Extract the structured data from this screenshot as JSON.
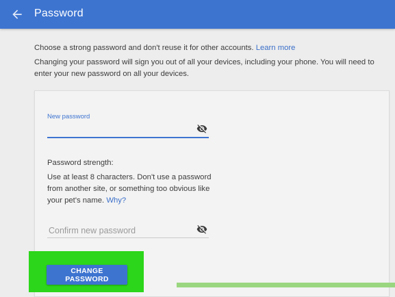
{
  "header": {
    "title": "Password",
    "back_icon": "arrow-back-icon"
  },
  "intro": {
    "line1": "Choose a strong password and don't reuse it for other accounts.",
    "learn_more": "Learn more",
    "line2": "Changing your password will sign you out of all your devices, including your phone. You will need to enter your new password on all your devices."
  },
  "form": {
    "new_password_label": "New password",
    "new_password_value": "",
    "strength_title": "Password strength:",
    "strength_text": "Use at least 8 characters. Don't use a password from another site, or something too obvious like your pet's name.",
    "why_link": "Why?",
    "confirm_placeholder": "Confirm new password",
    "visibility_icon": "visibility-off-icon"
  },
  "actions": {
    "change_password": "CHANGE PASSWORD"
  },
  "colors": {
    "accent": "#3d74d0",
    "highlight": "#2cd61a"
  }
}
